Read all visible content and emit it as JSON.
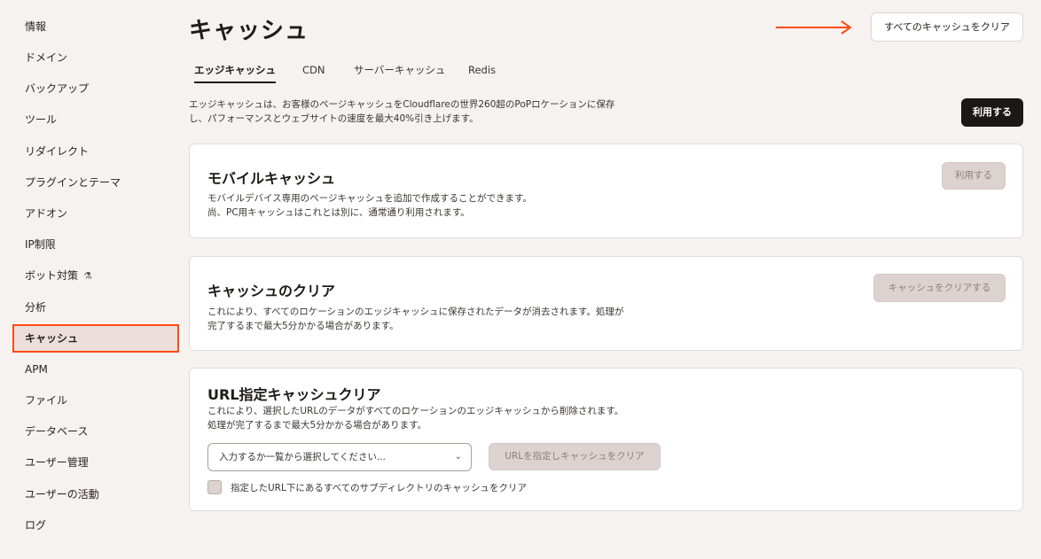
{
  "sidebar": {
    "items": [
      {
        "label": "情報"
      },
      {
        "label": "ドメイン"
      },
      {
        "label": "バックアップ"
      },
      {
        "label": "ツール"
      },
      {
        "label": "リダイレクト"
      },
      {
        "label": "プラグインとテーマ"
      },
      {
        "label": "アドオン"
      },
      {
        "label": "IP制限"
      },
      {
        "label": "ボット対策"
      },
      {
        "label": "分析"
      },
      {
        "label": "キャッシュ"
      },
      {
        "label": "APM"
      },
      {
        "label": "ファイル"
      },
      {
        "label": "データベース"
      },
      {
        "label": "ユーザー管理"
      },
      {
        "label": "ユーザーの活動"
      },
      {
        "label": "ログ"
      }
    ],
    "active": "キャッシュ",
    "flask_icon": "⚗"
  },
  "header": {
    "title": "キャッシュ",
    "clear_all_button": "すべてのキャッシュをクリア",
    "accent_color": "#ff4a14"
  },
  "tabs": [
    {
      "label": "エッジキャッシュ"
    },
    {
      "label": "CDN"
    },
    {
      "label": "サーバーキャッシュ"
    },
    {
      "label": "Redis"
    }
  ],
  "intro": {
    "line1": "エッジキャッシュは、お客様のページキャッシュをCloudflareの世界260超のPoPロケーションに保存",
    "line2": "し、パフォーマンスとウェブサイトの速度を最大40%引き上げます。",
    "enable_button": "利用する"
  },
  "mobile_cache": {
    "title": "モバイルキャッシュ",
    "desc1": "モバイルデバイス専用のページキャッシュを追加で作成することができます。",
    "desc2": "尚、PC用キャッシュはこれとは別に、通常通り利用されます。",
    "button": "利用する"
  },
  "clear_cache": {
    "title": "キャッシュのクリア",
    "desc1": "これにより、すべてのロケーションのエッジキャッシュに保存されたデータが消去されます。処理が",
    "desc2": "完了するまで最大5分かかる場合があります。",
    "button": "キャッシュをクリアする"
  },
  "url_clear": {
    "title": "URL指定キャッシュクリア",
    "desc1": "これにより、選択したURLのデータがすべてのロケーションのエッジキャッシュから削除されます。",
    "desc2": "処理が完了するまで最大5分かかる場合があります。",
    "select_placeholder": "入力するか一覧から選択してください...",
    "chevron": "⌄",
    "button": "URLを指定しキャッシュをクリア",
    "checkbox_label": "指定したURL下にあるすべてのサブディレクトリのキャッシュをクリア"
  }
}
